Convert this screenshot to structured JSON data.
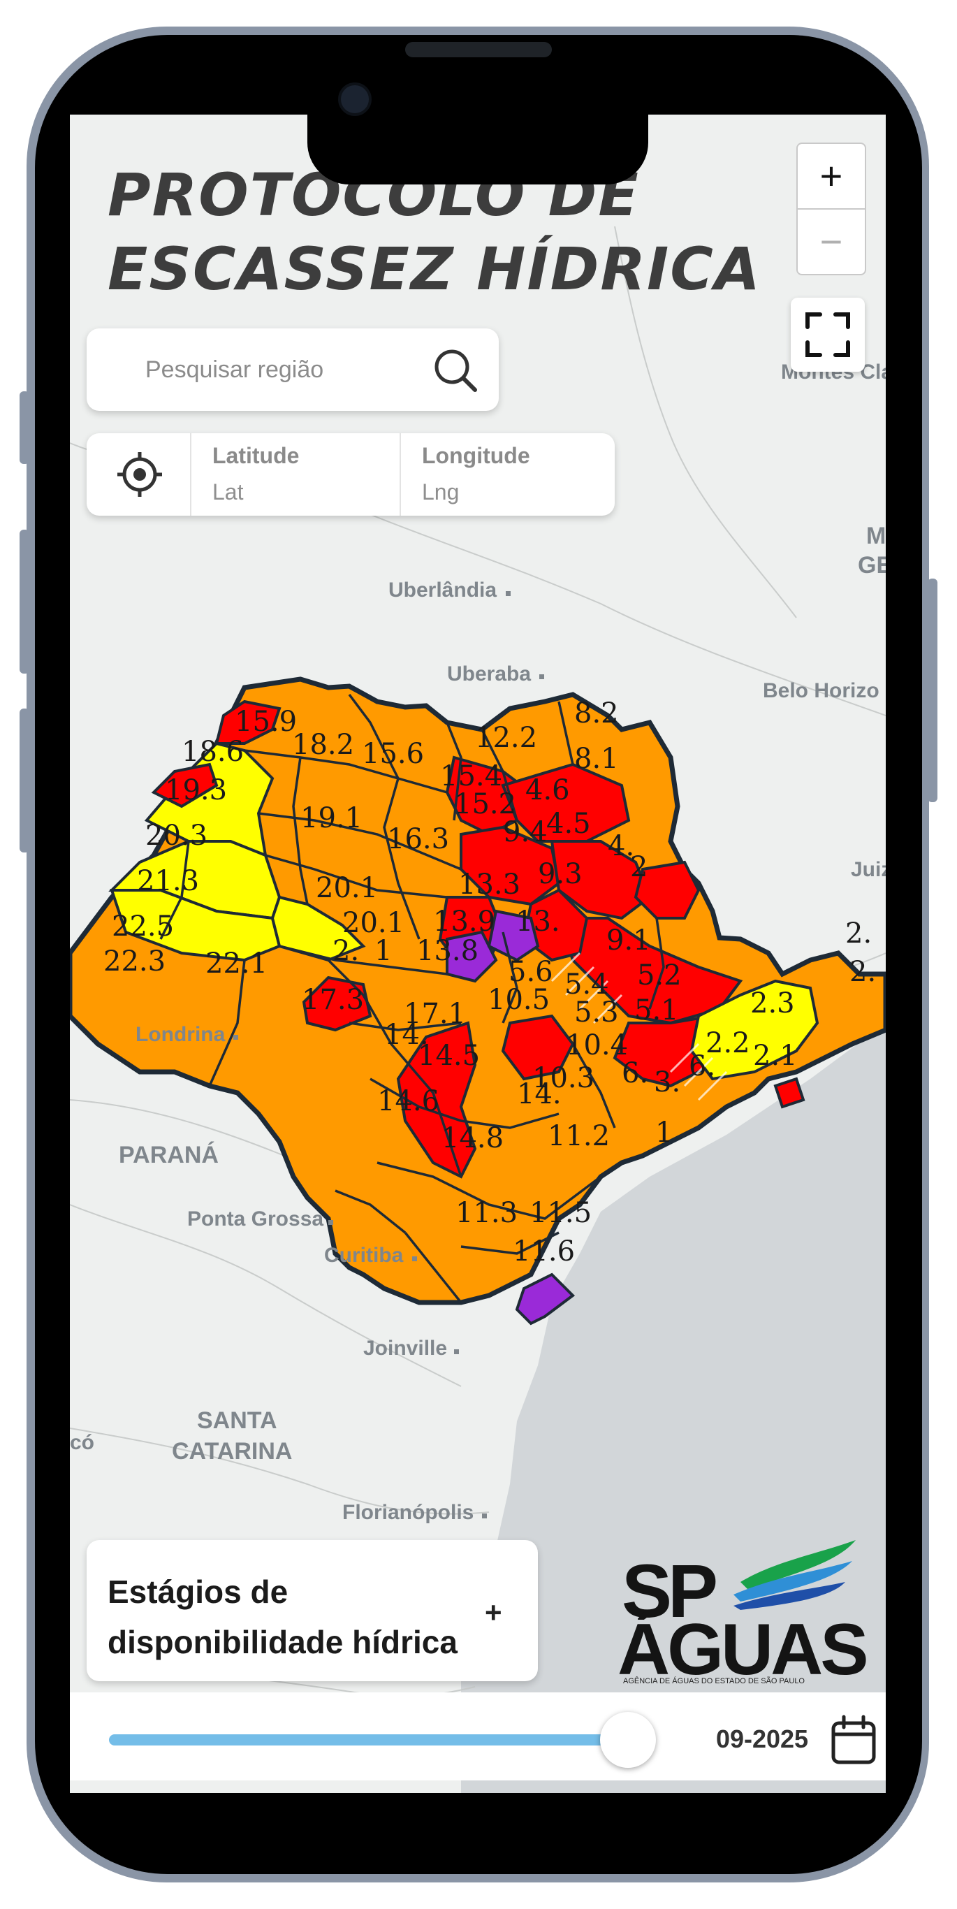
{
  "app": {
    "title_line1": "PROTOCOLO DE",
    "title_line2": "ESCASSEZ HÍDRICA"
  },
  "search": {
    "placeholder": "Pesquisar região",
    "icon": "search-icon"
  },
  "coordinates": {
    "locate_icon": "crosshair-icon",
    "latitude_label": "Latitude",
    "latitude_value": "Lat",
    "longitude_label": "Longitude",
    "longitude_value": "Lng"
  },
  "map_controls": {
    "zoom_in": "+",
    "zoom_out": "−",
    "fullscreen_icon": "fullscreen-icon"
  },
  "basemap_labels": {
    "uberlandia": "Uberlândia",
    "uberaba": "Uberaba",
    "belo_horizonte": "Belo Horizo",
    "montes_claros": "Montes Cla",
    "mg_1": "M",
    "mg_2": "GE",
    "juiz": "Juiz",
    "londrina": "Londrina",
    "parana": "PARANÁ",
    "ponta_grossa": "Ponta Grossa",
    "curitiba": "Curitiba",
    "joinville": "Joinville",
    "santa_catarina_1": "SANTA",
    "santa_catarina_2": "CATARINA",
    "florianopolis": "Florianópolis",
    "left_cut": "có"
  },
  "region_labels": {
    "r1": "15.9",
    "r2": "8.2",
    "r3": "18.6",
    "r4": "18.2",
    "r5": "15.6",
    "r6": "12.2",
    "r7": "8.1",
    "r8": "19.3",
    "r9": "15.4",
    "r10": "4.6",
    "r11": "15.2",
    "r12": "19.1",
    "r13": "9.4",
    "r14": "4.5",
    "r15": "20.3",
    "r16": "16.3",
    "r17": "4.",
    "r18": "21.3",
    "r19": "20.1",
    "r20": "13.3",
    "r21": "9.3",
    "r22": "2",
    "r23": "22.5",
    "r24": "13.9",
    "r25": "13.",
    "r26": "20.1",
    "r27": "22.3",
    "r28": "22.1",
    "r29": "2.",
    "r30": "1",
    "r31": "13.8",
    "r32": "9.1",
    "r33": "5.6",
    "r34": "5.4",
    "r35": "5.2",
    "r36": "17.3",
    "r37": "10.5",
    "r38": "17.1",
    "r39": "5.3",
    "r40": "5.1",
    "r41": "2.3",
    "r42": "14.",
    "r43": "10.4",
    "r44": "2.2",
    "r45": "14.5",
    "r46": "10.3",
    "r47": "6.",
    "r48": "3.",
    "r49": "6.",
    "r50": "2.1",
    "r51": "14.6",
    "r52": "14.",
    "r53": "14.8",
    "r54": "11.2",
    "r55": "1",
    "r56": "11.3",
    "r57": "11.5",
    "r58": "11.6",
    "r59": "2.",
    "r60": "2."
  },
  "stage_colors": {
    "normal": "#ffff00",
    "attention": "#ff9a00",
    "alert": "#ff0000",
    "critical": "#9a2ad8",
    "water": "#d2d6d9",
    "land": "#eef0ef"
  },
  "legend": {
    "title": "Estágios de disponibilidade hídrica",
    "expand": "+"
  },
  "logo": {
    "line1": "SP",
    "line2": "ÁGUAS",
    "tagline": "AGÊNCIA DE ÁGUAS DO ESTADO DE SÃO PAULO"
  },
  "timeline": {
    "progress": 0.94,
    "date": "09-2025",
    "calendar_icon": "calendar-icon"
  }
}
